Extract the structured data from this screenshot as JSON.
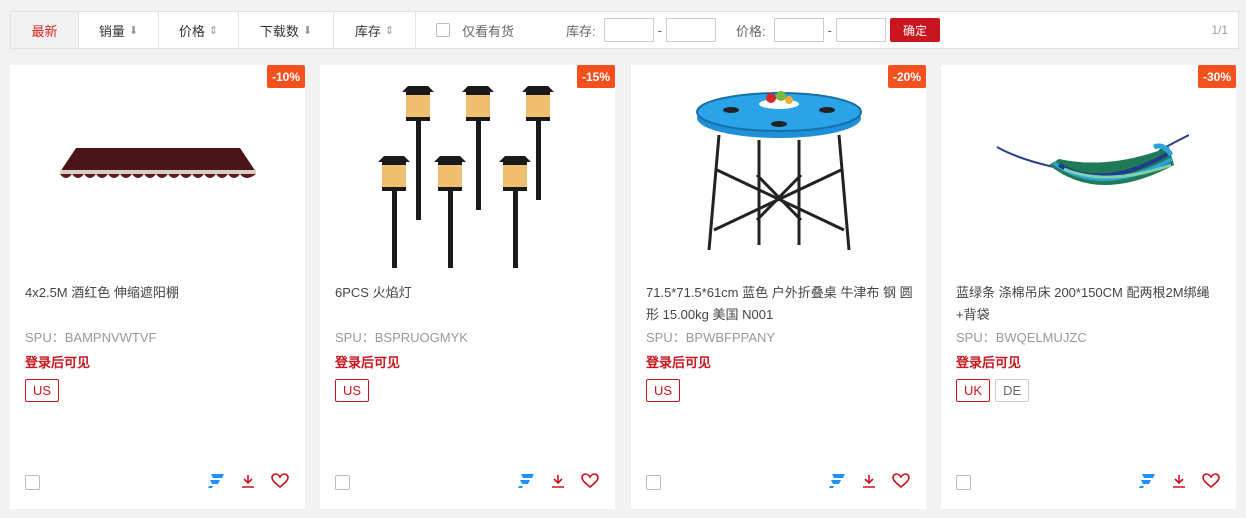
{
  "toolbar": {
    "tabs": [
      {
        "label": "最新",
        "arrow": ""
      },
      {
        "label": "销量",
        "arrow": "⬇"
      },
      {
        "label": "价格",
        "arrow": "⇕"
      },
      {
        "label": "下载数",
        "arrow": "⬇"
      },
      {
        "label": "库存",
        "arrow": "⇕"
      }
    ],
    "in_stock_label": "仅看有货",
    "stock_label": "库存:",
    "price_label": "价格:",
    "dash": "-",
    "confirm_label": "确定",
    "pager": "1/1"
  },
  "colors": {
    "accent": "#c9151e",
    "discount": "#f4511e",
    "icon_blue": "#1e90ff"
  },
  "products": [
    {
      "discount": "-10%",
      "title": "4x2.5M 酒红色 伸缩遮阳棚",
      "spu": "SPU：BAMPNVWTVF",
      "login": "登录后可见",
      "tags": [
        {
          "label": "US",
          "active": true
        }
      ],
      "image": "awning"
    },
    {
      "discount": "-15%",
      "title": "6PCS 火焰灯",
      "spu": "SPU：BSPRUOGMYK",
      "login": "登录后可见",
      "tags": [
        {
          "label": "US",
          "active": true
        }
      ],
      "image": "lamps"
    },
    {
      "discount": "-20%",
      "title": "71.5*71.5*61cm 蓝色 户外折叠桌 牛津布 钢 圆形 15.00kg 美国 N001",
      "spu": "SPU：BPWBFPPANY",
      "login": "登录后可见",
      "tags": [
        {
          "label": "US",
          "active": true
        }
      ],
      "image": "table"
    },
    {
      "discount": "-30%",
      "title": "蓝绿条 涤棉吊床 200*150CM 配两根2M绑绳+背袋",
      "spu": "SPU：BWQELMUJZC",
      "login": "登录后可见",
      "tags": [
        {
          "label": "UK",
          "active": true
        },
        {
          "label": "DE",
          "active": false
        }
      ],
      "image": "hammock"
    }
  ]
}
